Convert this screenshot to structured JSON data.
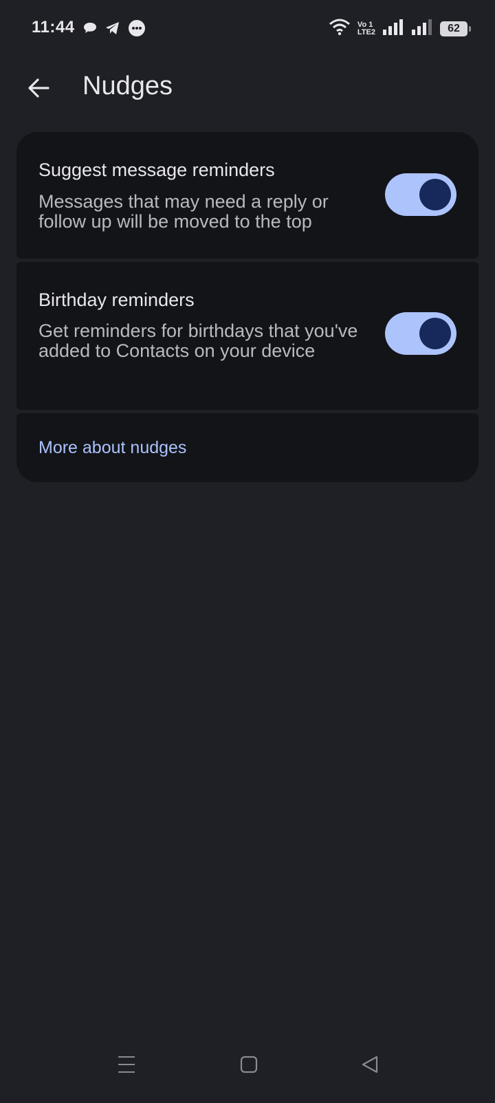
{
  "status_bar": {
    "time": "11:44",
    "notification_icons": [
      "chat-bubble-icon",
      "telegram-icon",
      "message-dots-icon"
    ],
    "volte_top": "Vo 1",
    "volte_bottom": "LTE2",
    "battery": "62"
  },
  "header": {
    "title": "Nudges",
    "back_icon": "arrow-back-icon"
  },
  "settings": [
    {
      "title": "Suggest message reminders",
      "description": "Messages that may need a reply or follow up will be moved to the top",
      "enabled": true
    },
    {
      "title": "Birthday reminders",
      "description": "Get reminders for birthdays that you've added to Contacts on your device",
      "enabled": true
    }
  ],
  "more_link": "More about nudges",
  "colors": {
    "background": "#1f2025",
    "card": "#131418",
    "toggle_track": "#adc3fb",
    "toggle_thumb": "#16295a",
    "link": "#aac2fb"
  },
  "nav_bar": [
    "menu-icon",
    "home-icon",
    "back-triangle-icon"
  ]
}
